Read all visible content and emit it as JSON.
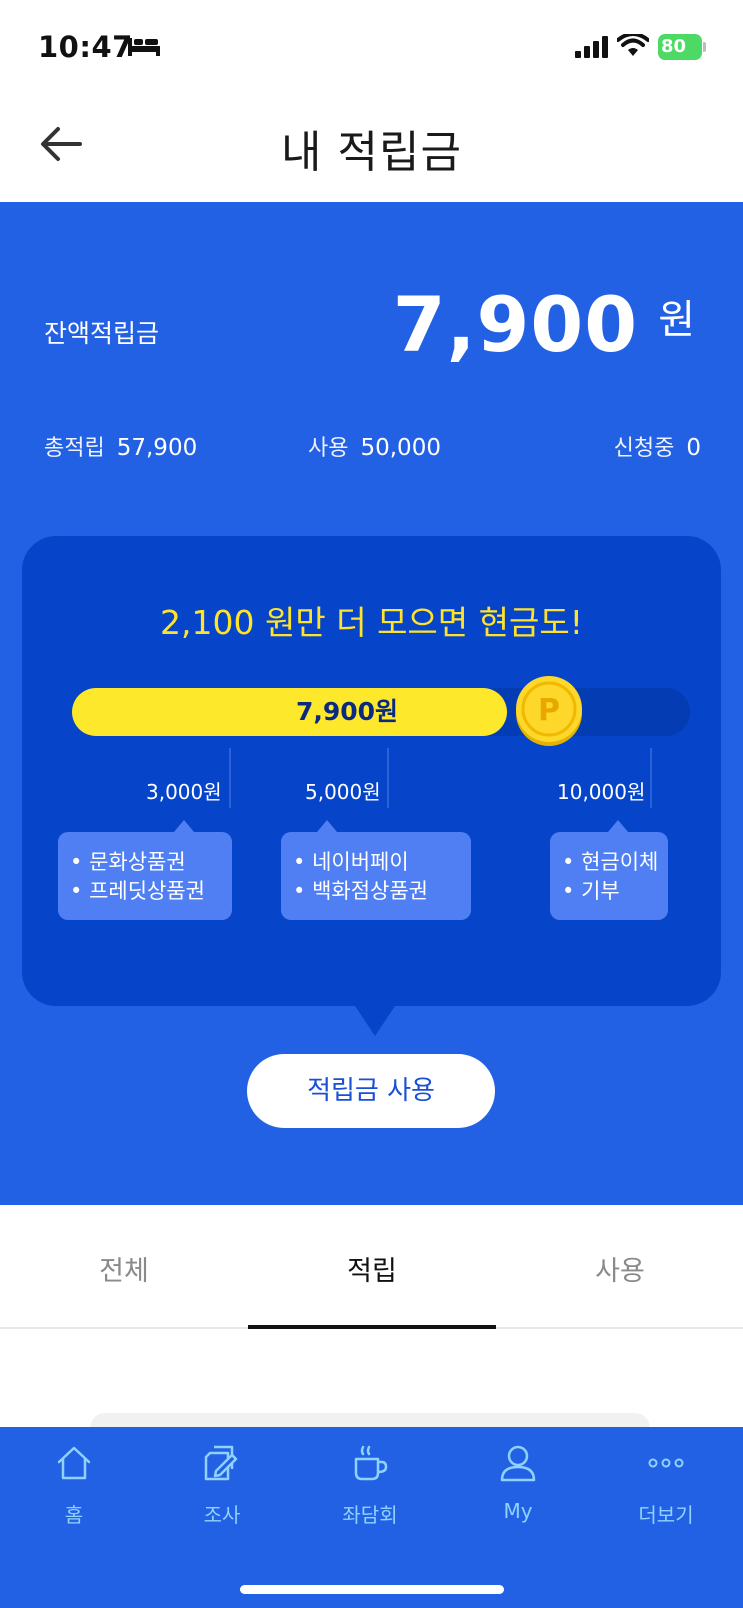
{
  "status_bar": {
    "time": "10:47",
    "battery": "80"
  },
  "header": {
    "title": "내 적립금"
  },
  "balance": {
    "label": "잔액적립금",
    "amount": "7,900",
    "unit": "원",
    "stats": {
      "total_label": "총적립",
      "total_value": "57,900",
      "used_label": "사용",
      "used_value": "50,000",
      "pending_label": "신청중",
      "pending_value": "0"
    }
  },
  "progress": {
    "headline": "2,100 원만 더 모으면 현금도!",
    "current_label": "7,900원",
    "current_value": 7900,
    "max_value": 10000,
    "coin_letter": "P",
    "thresholds": [
      {
        "label": "3,000원",
        "rewards": [
          "문화상품권",
          "프레딧상품권"
        ]
      },
      {
        "label": "5,000원",
        "rewards": [
          "네이버페이",
          "백화점상품권"
        ]
      },
      {
        "label": "10,000원",
        "rewards": [
          "현금이체",
          "기부"
        ]
      }
    ]
  },
  "actions": {
    "use_button": "적립금 사용"
  },
  "tabs": [
    {
      "label": "전체",
      "active": false
    },
    {
      "label": "적립",
      "active": true
    },
    {
      "label": "사용",
      "active": false
    }
  ],
  "bottom_nav": [
    {
      "label": "홈",
      "icon": "home-icon"
    },
    {
      "label": "조사",
      "icon": "survey-icon"
    },
    {
      "label": "좌담회",
      "icon": "cup-icon"
    },
    {
      "label": "My",
      "icon": "person-icon"
    },
    {
      "label": "더보기",
      "icon": "more-icon"
    }
  ],
  "colors": {
    "primary_blue": "#2361e4",
    "panel_blue": "#0645c9",
    "highlight_yellow": "#fde82c",
    "nav_label": "#8fd2ff"
  }
}
